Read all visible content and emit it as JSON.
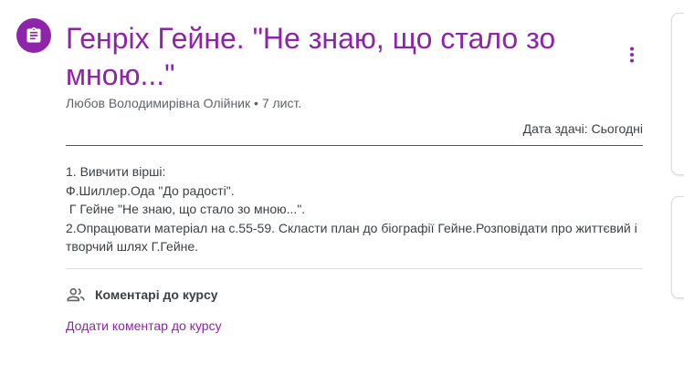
{
  "assignment": {
    "icon": "assignment-icon",
    "title": "Генріх Гейне. \"Не знаю, що стало зо мною...\"",
    "author": "Любов Володимирівна Олійник",
    "separator": "•",
    "posted": "7 лист.",
    "due_label": "Дата здачі:",
    "due_value": "Сьогодні",
    "more_icon": "more-vert-icon"
  },
  "instructions": [
    "1. Вивчити вірші:",
    "Ф.Шиллер.Ода \"До радості\".",
    " Г Гейне \"Не знаю, що стало зо мною...\".",
    "2.Опрацювати матеріал на с.55-59. Скласти план до біографії Гейне.Розповідати про життєвий і творчий шлях Г.Гейне."
  ],
  "comments": {
    "icon": "people-icon",
    "title": "Коментарі до курсу",
    "add_link": "Додати коментар до курсу"
  },
  "colors": {
    "accent": "#8e24aa",
    "text": "#3c4043",
    "secondary_text": "#5f6368",
    "divider": "#dadce0"
  }
}
